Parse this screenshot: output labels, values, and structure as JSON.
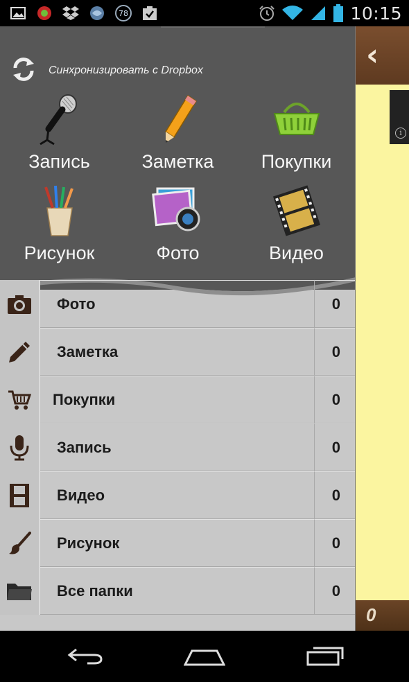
{
  "status_bar": {
    "time": "10:15",
    "badge": "78",
    "icons": [
      "gallery-icon",
      "app-icon",
      "dropbox-icon",
      "browser-icon",
      "badge-icon",
      "task-icon",
      "alarm-icon",
      "wifi-icon",
      "signal-icon",
      "battery-icon"
    ]
  },
  "drawer": {
    "sync_label": "Синхронизировать с Dropbox",
    "quick_actions": [
      {
        "label": "Запись",
        "icon": "microphone-icon"
      },
      {
        "label": "Заметка",
        "icon": "pencil-icon"
      },
      {
        "label": "Покупки",
        "icon": "basket-icon"
      },
      {
        "label": "Рисунок",
        "icon": "brushes-icon"
      },
      {
        "label": "Фото",
        "icon": "photo-icon"
      },
      {
        "label": "Видео",
        "icon": "film-icon"
      }
    ],
    "list": [
      {
        "label": "Фото",
        "count": "0",
        "icon": "camera-icon"
      },
      {
        "label": "Заметка",
        "count": "0",
        "icon": "pen-icon"
      },
      {
        "label": "Покупки",
        "count": "0",
        "icon": "cart-icon"
      },
      {
        "label": "Запись",
        "count": "0",
        "icon": "mic-icon"
      },
      {
        "label": "Видео",
        "count": "0",
        "icon": "film-strip-icon"
      },
      {
        "label": "Рисунок",
        "count": "0",
        "icon": "brush-icon"
      },
      {
        "label": "Все папки",
        "count": "0",
        "icon": "folder-icon"
      }
    ]
  },
  "background_app": {
    "count": "0"
  },
  "colors": {
    "drawer_header": "#575757",
    "drawer_list": "#c8c8c8",
    "bg_app_paper": "#fbf5a0",
    "bg_app_bar": "#6a4426"
  }
}
